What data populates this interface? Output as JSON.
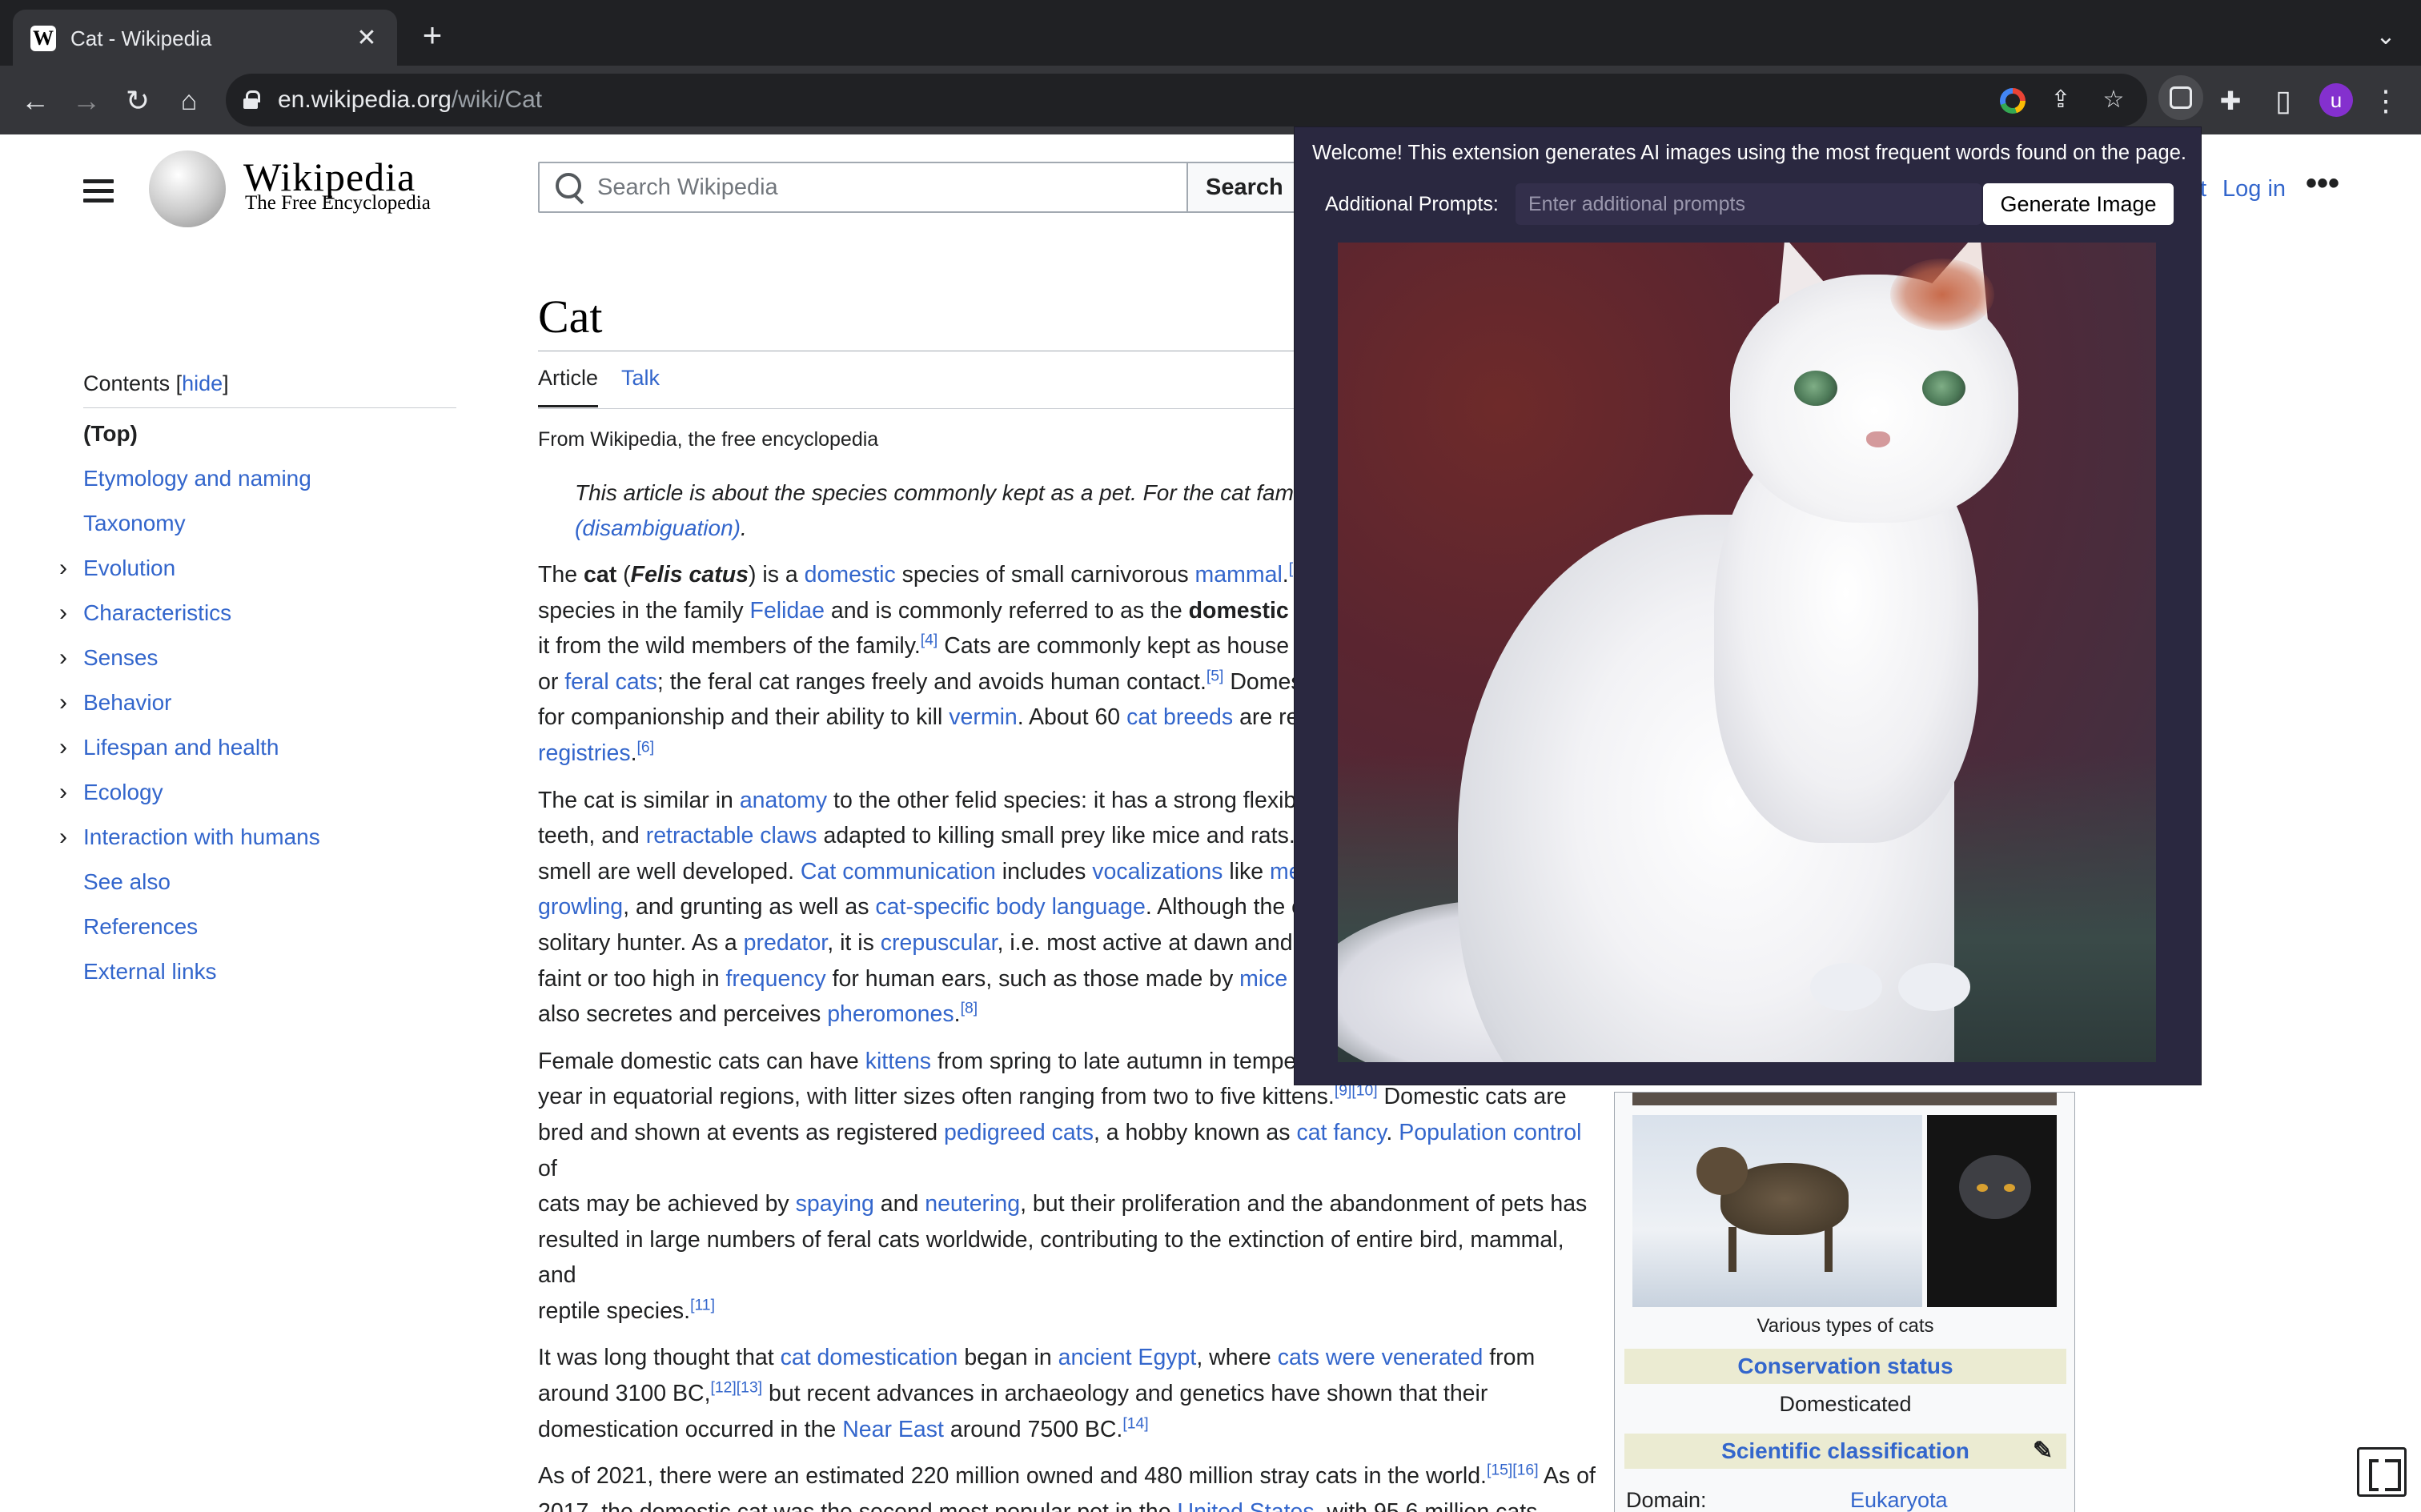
{
  "browser": {
    "tab_title": "Cat - Wikipedia",
    "tab_favicon": "W",
    "url_host": "en.wikipedia.org",
    "url_path": "/wiki/Cat",
    "avatar_letter": "u",
    "icons": [
      "back-icon",
      "forward-icon",
      "reload-icon",
      "home-icon",
      "lock-icon",
      "google-lens-icon",
      "share-icon",
      "bookmark-star-icon",
      "extension-active-icon",
      "puzzle-extensions-icon",
      "side-panel-icon",
      "kebab-menu-icon",
      "new-tab-icon",
      "tab-close-icon",
      "tab-search-icon"
    ]
  },
  "wiki_header": {
    "wordmark": "Wikipedia",
    "tagline": "The Free Encyclopedia",
    "search_placeholder": "Search Wikipedia",
    "search_button": "Search",
    "login": "Log in",
    "login_prev": "t",
    "more": "•••"
  },
  "toc": {
    "title": "Contents",
    "hide_label": "hide",
    "items": [
      {
        "label": "(Top)",
        "expandable": false,
        "current": true
      },
      {
        "label": "Etymology and naming",
        "expandable": false
      },
      {
        "label": "Taxonomy",
        "expandable": false
      },
      {
        "label": "Evolution",
        "expandable": true
      },
      {
        "label": "Characteristics",
        "expandable": true
      },
      {
        "label": "Senses",
        "expandable": true
      },
      {
        "label": "Behavior",
        "expandable": true
      },
      {
        "label": "Lifespan and health",
        "expandable": true
      },
      {
        "label": "Ecology",
        "expandable": true
      },
      {
        "label": "Interaction with humans",
        "expandable": true
      },
      {
        "label": "See also",
        "expandable": false
      },
      {
        "label": "References",
        "expandable": false
      },
      {
        "label": "External links",
        "expandable": false
      }
    ]
  },
  "article": {
    "title": "Cat",
    "tabs": [
      "Article",
      "Talk"
    ],
    "from": "From Wikipedia, the free encyclopedia",
    "hatnote_1": "This article is about the species commonly kept as a pet. For the cat fam",
    "hatnote_2": "(disambiguation)",
    "hatnote_end": "."
  },
  "extension": {
    "welcome": "Welcome! This extension generates AI images using the most frequent words found on the page.",
    "prompt_label": "Additional Prompts:",
    "prompt_placeholder": "Enter additional prompts",
    "generate_button": "Generate Image"
  },
  "infobox": {
    "caption": "Various types of cats",
    "conservation_header": "Conservation status",
    "conservation_value": "Domesticated",
    "classification_header": "Scientific classification",
    "domain_label": "Domain:",
    "domain_value": "Eukaryota"
  }
}
